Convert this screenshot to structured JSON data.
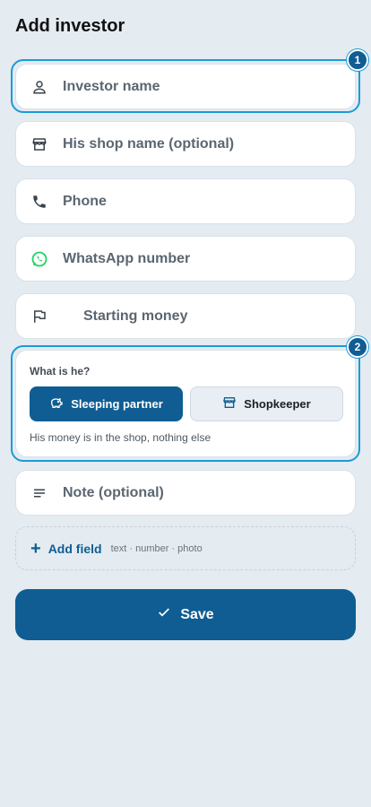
{
  "title": "Add investor",
  "fields": {
    "name": "Investor name",
    "shop": "His shop name (optional)",
    "phone": "Phone",
    "whatsapp": "WhatsApp number",
    "money": "Starting money",
    "note": "Note (optional)"
  },
  "badges": {
    "one": "1",
    "two": "2"
  },
  "type_card": {
    "question": "What is he?",
    "sleeping_partner": "Sleeping partner",
    "shopkeeper": "Shopkeeper",
    "selected": "Sleeping partner",
    "help": "His money is in the shop, nothing else"
  },
  "add_field": {
    "plus": "+",
    "label": "Add field",
    "hint": "text · number · photo"
  },
  "save": {
    "label": "Save"
  },
  "icons": {
    "name": "person-icon",
    "shop": "storefront-icon",
    "phone": "phone-icon",
    "whatsapp": "whatsapp-icon",
    "money": "flag-icon",
    "note": "notes-icon",
    "sleeping": "piggy-bank-icon",
    "shopkeeper": "storefront-icon",
    "save": "check-icon"
  },
  "colors": {
    "accent": "#0f5d93",
    "highlight": "#1a9bd7",
    "whatsapp": "#25d366"
  }
}
